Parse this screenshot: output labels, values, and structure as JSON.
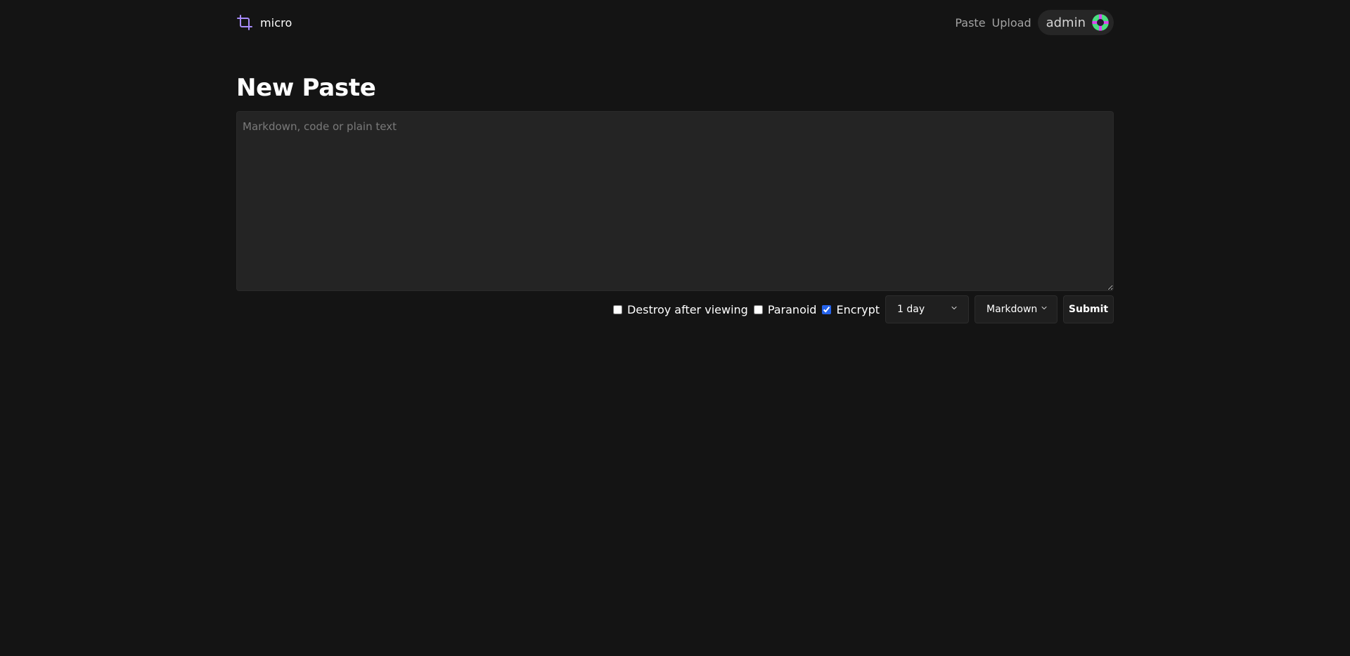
{
  "header": {
    "brand": "micro",
    "brand_icon": "crop-icon",
    "accent_color": "#a78bfa",
    "nav": [
      {
        "label": "Paste"
      },
      {
        "label": "Upload"
      }
    ],
    "user": {
      "name": "admin",
      "avatar_icon": "avatar-icon"
    }
  },
  "main": {
    "title": "New Paste",
    "editor": {
      "placeholder": "Markdown, code or plain text",
      "value": ""
    },
    "options": {
      "destroy_after_viewing": {
        "label": "Destroy after viewing",
        "checked": false
      },
      "paranoid": {
        "label": "Paranoid",
        "checked": false
      },
      "encrypt": {
        "label": "Encrypt",
        "checked": true
      },
      "expiry": {
        "selected": "1 day"
      },
      "language": {
        "selected": "Markdown"
      },
      "submit_label": "Submit"
    }
  }
}
